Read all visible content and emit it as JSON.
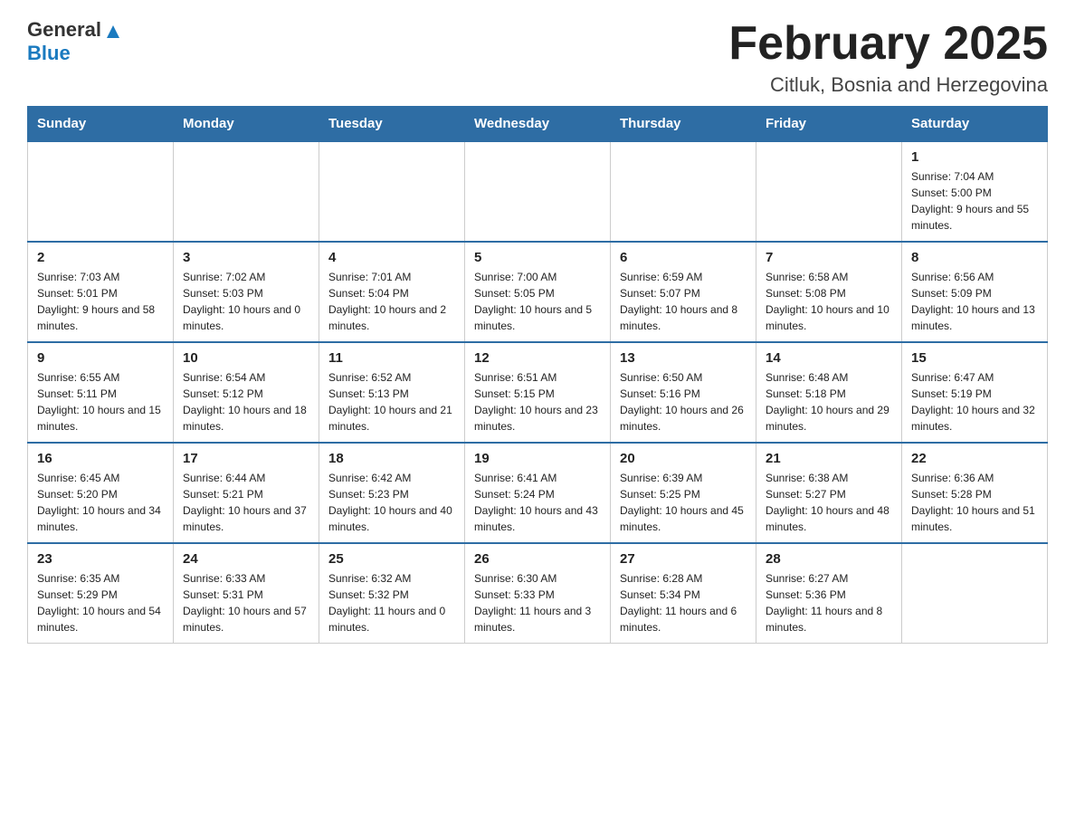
{
  "header": {
    "logo_general": "General",
    "logo_blue": "Blue",
    "month_title": "February 2025",
    "location": "Citluk, Bosnia and Herzegovina"
  },
  "days_of_week": [
    "Sunday",
    "Monday",
    "Tuesday",
    "Wednesday",
    "Thursday",
    "Friday",
    "Saturday"
  ],
  "weeks": [
    [
      {
        "day": "",
        "sunrise": "",
        "sunset": "",
        "daylight": ""
      },
      {
        "day": "",
        "sunrise": "",
        "sunset": "",
        "daylight": ""
      },
      {
        "day": "",
        "sunrise": "",
        "sunset": "",
        "daylight": ""
      },
      {
        "day": "",
        "sunrise": "",
        "sunset": "",
        "daylight": ""
      },
      {
        "day": "",
        "sunrise": "",
        "sunset": "",
        "daylight": ""
      },
      {
        "day": "",
        "sunrise": "",
        "sunset": "",
        "daylight": ""
      },
      {
        "day": "1",
        "sunrise": "Sunrise: 7:04 AM",
        "sunset": "Sunset: 5:00 PM",
        "daylight": "Daylight: 9 hours and 55 minutes."
      }
    ],
    [
      {
        "day": "2",
        "sunrise": "Sunrise: 7:03 AM",
        "sunset": "Sunset: 5:01 PM",
        "daylight": "Daylight: 9 hours and 58 minutes."
      },
      {
        "day": "3",
        "sunrise": "Sunrise: 7:02 AM",
        "sunset": "Sunset: 5:03 PM",
        "daylight": "Daylight: 10 hours and 0 minutes."
      },
      {
        "day": "4",
        "sunrise": "Sunrise: 7:01 AM",
        "sunset": "Sunset: 5:04 PM",
        "daylight": "Daylight: 10 hours and 2 minutes."
      },
      {
        "day": "5",
        "sunrise": "Sunrise: 7:00 AM",
        "sunset": "Sunset: 5:05 PM",
        "daylight": "Daylight: 10 hours and 5 minutes."
      },
      {
        "day": "6",
        "sunrise": "Sunrise: 6:59 AM",
        "sunset": "Sunset: 5:07 PM",
        "daylight": "Daylight: 10 hours and 8 minutes."
      },
      {
        "day": "7",
        "sunrise": "Sunrise: 6:58 AM",
        "sunset": "Sunset: 5:08 PM",
        "daylight": "Daylight: 10 hours and 10 minutes."
      },
      {
        "day": "8",
        "sunrise": "Sunrise: 6:56 AM",
        "sunset": "Sunset: 5:09 PM",
        "daylight": "Daylight: 10 hours and 13 minutes."
      }
    ],
    [
      {
        "day": "9",
        "sunrise": "Sunrise: 6:55 AM",
        "sunset": "Sunset: 5:11 PM",
        "daylight": "Daylight: 10 hours and 15 minutes."
      },
      {
        "day": "10",
        "sunrise": "Sunrise: 6:54 AM",
        "sunset": "Sunset: 5:12 PM",
        "daylight": "Daylight: 10 hours and 18 minutes."
      },
      {
        "day": "11",
        "sunrise": "Sunrise: 6:52 AM",
        "sunset": "Sunset: 5:13 PM",
        "daylight": "Daylight: 10 hours and 21 minutes."
      },
      {
        "day": "12",
        "sunrise": "Sunrise: 6:51 AM",
        "sunset": "Sunset: 5:15 PM",
        "daylight": "Daylight: 10 hours and 23 minutes."
      },
      {
        "day": "13",
        "sunrise": "Sunrise: 6:50 AM",
        "sunset": "Sunset: 5:16 PM",
        "daylight": "Daylight: 10 hours and 26 minutes."
      },
      {
        "day": "14",
        "sunrise": "Sunrise: 6:48 AM",
        "sunset": "Sunset: 5:18 PM",
        "daylight": "Daylight: 10 hours and 29 minutes."
      },
      {
        "day": "15",
        "sunrise": "Sunrise: 6:47 AM",
        "sunset": "Sunset: 5:19 PM",
        "daylight": "Daylight: 10 hours and 32 minutes."
      }
    ],
    [
      {
        "day": "16",
        "sunrise": "Sunrise: 6:45 AM",
        "sunset": "Sunset: 5:20 PM",
        "daylight": "Daylight: 10 hours and 34 minutes."
      },
      {
        "day": "17",
        "sunrise": "Sunrise: 6:44 AM",
        "sunset": "Sunset: 5:21 PM",
        "daylight": "Daylight: 10 hours and 37 minutes."
      },
      {
        "day": "18",
        "sunrise": "Sunrise: 6:42 AM",
        "sunset": "Sunset: 5:23 PM",
        "daylight": "Daylight: 10 hours and 40 minutes."
      },
      {
        "day": "19",
        "sunrise": "Sunrise: 6:41 AM",
        "sunset": "Sunset: 5:24 PM",
        "daylight": "Daylight: 10 hours and 43 minutes."
      },
      {
        "day": "20",
        "sunrise": "Sunrise: 6:39 AM",
        "sunset": "Sunset: 5:25 PM",
        "daylight": "Daylight: 10 hours and 45 minutes."
      },
      {
        "day": "21",
        "sunrise": "Sunrise: 6:38 AM",
        "sunset": "Sunset: 5:27 PM",
        "daylight": "Daylight: 10 hours and 48 minutes."
      },
      {
        "day": "22",
        "sunrise": "Sunrise: 6:36 AM",
        "sunset": "Sunset: 5:28 PM",
        "daylight": "Daylight: 10 hours and 51 minutes."
      }
    ],
    [
      {
        "day": "23",
        "sunrise": "Sunrise: 6:35 AM",
        "sunset": "Sunset: 5:29 PM",
        "daylight": "Daylight: 10 hours and 54 minutes."
      },
      {
        "day": "24",
        "sunrise": "Sunrise: 6:33 AM",
        "sunset": "Sunset: 5:31 PM",
        "daylight": "Daylight: 10 hours and 57 minutes."
      },
      {
        "day": "25",
        "sunrise": "Sunrise: 6:32 AM",
        "sunset": "Sunset: 5:32 PM",
        "daylight": "Daylight: 11 hours and 0 minutes."
      },
      {
        "day": "26",
        "sunrise": "Sunrise: 6:30 AM",
        "sunset": "Sunset: 5:33 PM",
        "daylight": "Daylight: 11 hours and 3 minutes."
      },
      {
        "day": "27",
        "sunrise": "Sunrise: 6:28 AM",
        "sunset": "Sunset: 5:34 PM",
        "daylight": "Daylight: 11 hours and 6 minutes."
      },
      {
        "day": "28",
        "sunrise": "Sunrise: 6:27 AM",
        "sunset": "Sunset: 5:36 PM",
        "daylight": "Daylight: 11 hours and 8 minutes."
      },
      {
        "day": "",
        "sunrise": "",
        "sunset": "",
        "daylight": ""
      }
    ]
  ]
}
